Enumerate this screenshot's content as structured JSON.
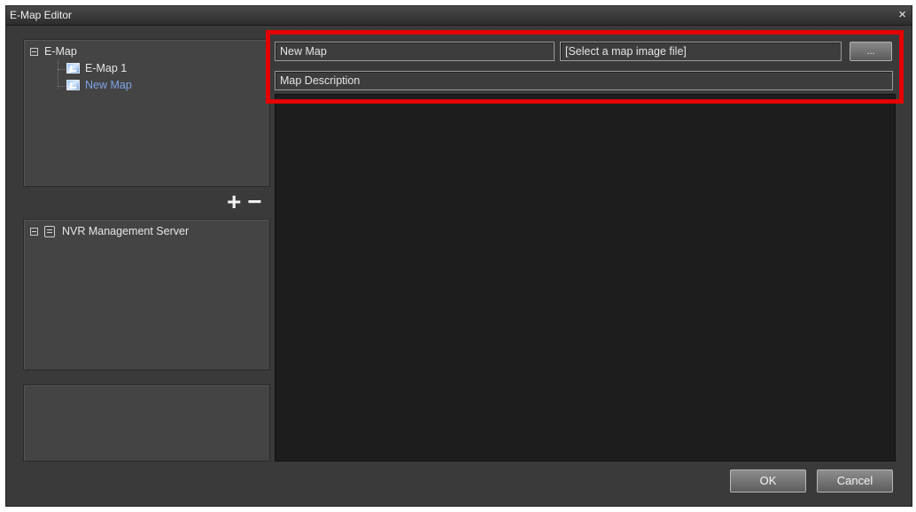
{
  "window": {
    "title": "E-Map Editor",
    "close_glyph": "×"
  },
  "tree": {
    "root_label": "E-Map",
    "items": [
      {
        "label": "E-Map 1",
        "icon": "map-icon"
      },
      {
        "label": "New Map",
        "icon": "map-icon",
        "selected": true
      }
    ]
  },
  "server_tree": {
    "root_label": "NVR Management Server",
    "icon": "server-icon"
  },
  "tree_controls": {
    "add_label": "+",
    "remove_label": "−"
  },
  "form": {
    "map_name_value": "New Map",
    "map_file_value": "[Select a map image file]",
    "browse_label": "...",
    "description_value": "Map Description"
  },
  "footer": {
    "ok_label": "OK",
    "cancel_label": "Cancel"
  },
  "colors": {
    "highlight": "#e50000",
    "selected_text": "#7fa3e8",
    "canvas": "#1d1d1d"
  }
}
